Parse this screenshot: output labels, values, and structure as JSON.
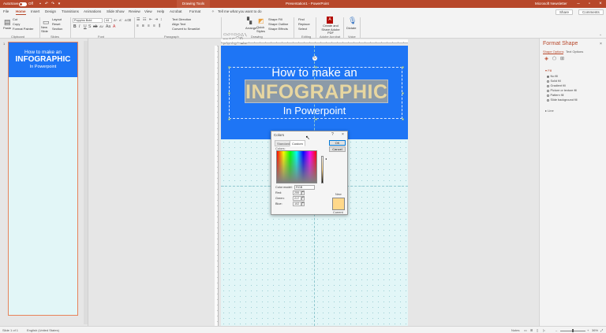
{
  "titlebar": {
    "autosave_label": "AutoSave",
    "autosave_state": "Off",
    "context_tab": "Drawing Tools",
    "document_title": "Presentation1 - PowerPoint",
    "user_name": "Microsoft Newsletter",
    "minimize_icon": "minimize-icon",
    "maximize_icon": "maximize-icon",
    "close_icon": "close-icon"
  },
  "tabs": [
    "File",
    "Home",
    "Insert",
    "Design",
    "Transitions",
    "Animations",
    "Slide Show",
    "Review",
    "View",
    "Help",
    "Acrobat",
    "Format"
  ],
  "active_tab": "Home",
  "tell_me": "Tell me what you want to do",
  "share_label": "Share",
  "comments_label": "Comments",
  "ribbon": {
    "clipboard": {
      "paste": "Paste",
      "cut": "Cut",
      "copy": "Copy",
      "format_painter": "Format Painter",
      "group": "Clipboard"
    },
    "slides": {
      "new_slide": "New Slide",
      "layout": "Layout",
      "reset": "Reset",
      "section": "Section",
      "group": "Slides"
    },
    "font": {
      "font_name": "Poppins Bold",
      "font_size": "44",
      "group": "Font"
    },
    "paragraph": {
      "text_direction": "Text Direction",
      "align_text": "Align Text",
      "convert_smartart": "Convert to SmartArt",
      "group": "Paragraph"
    },
    "drawing": {
      "arrange": "Arrange",
      "quick_styles": "Quick Styles",
      "shape_fill": "Shape Fill",
      "shape_outline": "Shape Outline",
      "shape_effects": "Shape Effects",
      "group": "Drawing"
    },
    "editing": {
      "find": "Find",
      "replace": "Replace",
      "select": "Select",
      "group": "Editing"
    },
    "acrobat": {
      "create_share": "Create and Share Adobe PDF",
      "group": "Adobe Acrobat"
    },
    "voice": {
      "dictate": "Dictate",
      "group": "Voice"
    }
  },
  "thumbnail": {
    "slide_number": "1",
    "line1": "How to make an",
    "line2": "INFOGRAPHIC",
    "line3": "In Powerpoint"
  },
  "slide": {
    "line1": "How to make an",
    "line2": "INFOGRAPHIC",
    "line3": "In Powerpoint"
  },
  "colors_dialog": {
    "title": "Colors",
    "help": "?",
    "close": "×",
    "tabs": [
      "Standard",
      "Custom"
    ],
    "active_tab": "Custom",
    "colors_label": "Colors:",
    "color_model_label": "Color model:",
    "color_model_value": "RGB",
    "red_label": "Red:",
    "red_value": "255",
    "green_label": "Green:",
    "green_value": "217",
    "blue_label": "Blue:",
    "blue_value": "102",
    "ok": "OK",
    "cancel": "Cancel",
    "new_label": "New",
    "current_label": "Current",
    "new_color": "#ffd88a"
  },
  "format_pane": {
    "title": "Format Shape",
    "close": "×",
    "tabs": [
      "Shape Options",
      "Text Options"
    ],
    "active_tab": "Shape Options",
    "fill_section": "Fill",
    "options": [
      "No fill",
      "Solid fill",
      "Gradient fill",
      "Picture or texture fill",
      "Pattern fill",
      "Slide background fill"
    ],
    "selected_option": "No fill",
    "line_section": "Line"
  },
  "statusbar": {
    "slide_info": "Slide 1 of 1",
    "language": "English (United States)",
    "notes": "Notes",
    "zoom": "36%"
  },
  "colors": {
    "accent": "#b7472a",
    "slide_header": "#1e75f5",
    "slide_bg": "#e2f6f7"
  }
}
